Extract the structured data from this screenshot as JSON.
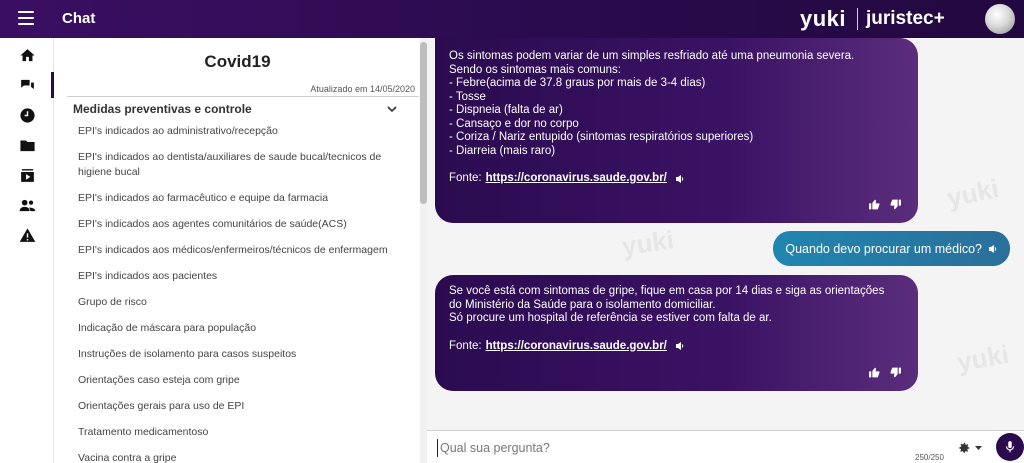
{
  "header": {
    "title": "Chat",
    "brand_primary": "yuki",
    "brand_secondary": "juristec+",
    "colors": {
      "bar": "#2a0b4d",
      "accent_user": "#2580ad"
    }
  },
  "rail": {
    "items": [
      {
        "name": "home-icon",
        "active": false
      },
      {
        "name": "chat-icon",
        "active": true
      },
      {
        "name": "clock-icon",
        "active": false
      },
      {
        "name": "folder-icon",
        "active": false
      },
      {
        "name": "media-icon",
        "active": false
      },
      {
        "name": "people-icon",
        "active": false
      },
      {
        "name": "warning-icon",
        "active": false
      }
    ]
  },
  "panel": {
    "title": "Covid19",
    "updated": "Atualizado em 14/05/2020",
    "section_title": "Medidas preventivas e controle",
    "topics": [
      "EPI's indicados ao administrativo/recepção",
      "EPI's indicados ao dentista/auxiliares de saude bucal/tecnicos de higiene bucal",
      "EPI's indicados ao farmacêutico e equipe da farmacia",
      "EPI's indicados aos agentes comunitários de saúde(ACS)",
      "EPI's indicados aos médicos/enfermeiros/técnicos de enfermagem",
      "EPI's indicados aos pacientes",
      "Grupo de risco",
      "Indicação de máscara para população",
      "Instruções de isolamento para casos suspeitos",
      "Orientações caso esteja com gripe",
      "Orientações gerais para uso de EPI",
      "Tratamento medicamentoso",
      "Vacina contra a gripe"
    ]
  },
  "chat": {
    "watermark": "yuki",
    "messages": [
      {
        "from": "bot",
        "lines": [
          "Os sintomas podem variar de um simples resfriado até uma pneumonia severa.",
          "Sendo os sintomas mais comuns:",
          "- Febre(acima de 37.8 graus por mais de 3-4 dias)",
          "- Tosse",
          "- Dispneia (falta de ar)",
          "- Cansaço e dor no corpo",
          "- Coriza / Nariz entupido (sintomas respiratórios superiores)",
          "- Diarreia (mais raro)"
        ],
        "source_label": "Fonte:",
        "source_link": "https://coronavirus.saude.gov.br/"
      },
      {
        "from": "user",
        "text": "Quando devo procurar um médico?"
      },
      {
        "from": "bot",
        "lines": [
          "Se você está com sintomas de gripe, fique em casa por 14 dias e siga as orientações",
          "do Ministério da Saúde para o isolamento domiciliar.",
          "Só procure um hospital de referência se estiver com falta de ar."
        ],
        "source_label": "Fonte:",
        "source_link": "https://coronavirus.saude.gov.br/"
      }
    ]
  },
  "input": {
    "placeholder": "Qual sua pergunta?",
    "counter": "250/250"
  }
}
